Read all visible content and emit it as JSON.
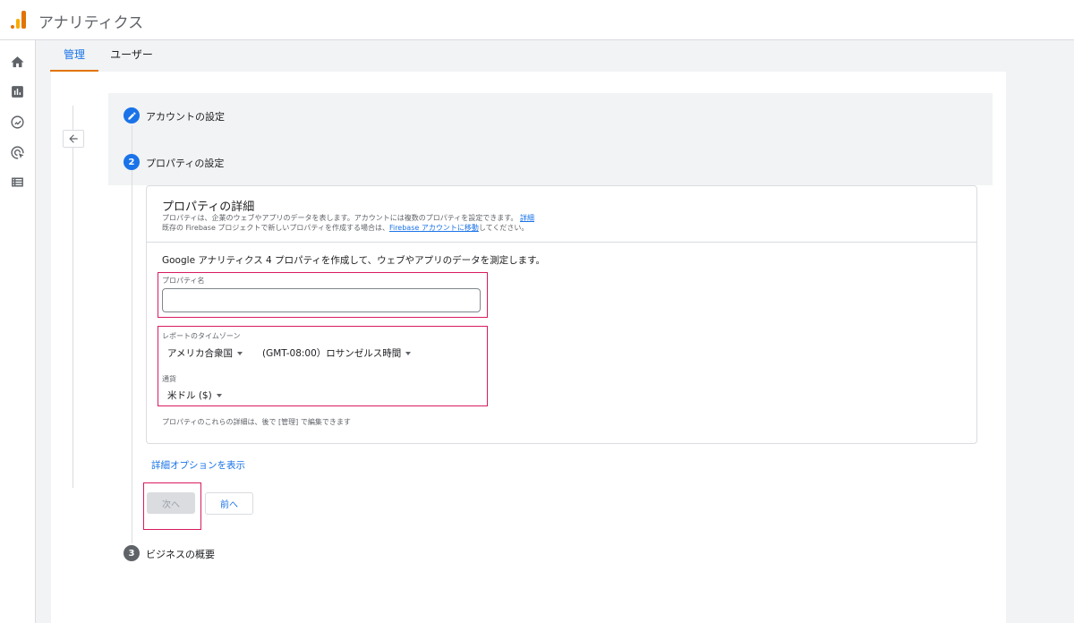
{
  "app": {
    "title": "アナリティクス"
  },
  "nav": {
    "icons": [
      "home-icon",
      "reports-icon",
      "explore-icon",
      "advertising-icon",
      "configure-icon"
    ]
  },
  "tabs": [
    {
      "label": "管理",
      "active": true
    },
    {
      "label": "ユーザー",
      "active": false
    }
  ],
  "steps": [
    {
      "marker": "edit",
      "label": "アカウントの設定"
    },
    {
      "marker": "2",
      "label": "プロパティの設定"
    },
    {
      "marker": "3",
      "label": "ビジネスの概要"
    }
  ],
  "card": {
    "title": "プロパティの詳細",
    "desc1": "プロパティは、企業のウェブやアプリのデータを表します。アカウントには複数のプロパティを設定できます。",
    "desc1_link": "詳細",
    "desc2_prefix": "既存の Firebase プロジェクトで新しいプロパティを作成する場合は、",
    "desc2_link": "Firebase アカウントに移動",
    "desc2_suffix": "してください。",
    "intro": "Google アナリティクス 4 プロパティを作成して、ウェブやアプリのデータを測定します。",
    "property_name_label": "プロパティ名",
    "property_name_value": "",
    "timezone_label": "レポートのタイムゾーン",
    "timezone_country": "アメリカ合衆国",
    "timezone_value": "(GMT-08:00）ロサンゼルス時間",
    "currency_label": "通貨",
    "currency_value": "米ドル ($)",
    "note": "プロパティのこれらの詳細は、後で [管理] で編集できます"
  },
  "advanced_link": "詳細オプションを表示",
  "buttons": {
    "next": "次へ",
    "prev": "前へ"
  },
  "colors": {
    "accent": "#1a73e8",
    "highlight": "#d81b60",
    "brand_orange": "#e37400",
    "brand_yellow": "#f9ab00"
  }
}
